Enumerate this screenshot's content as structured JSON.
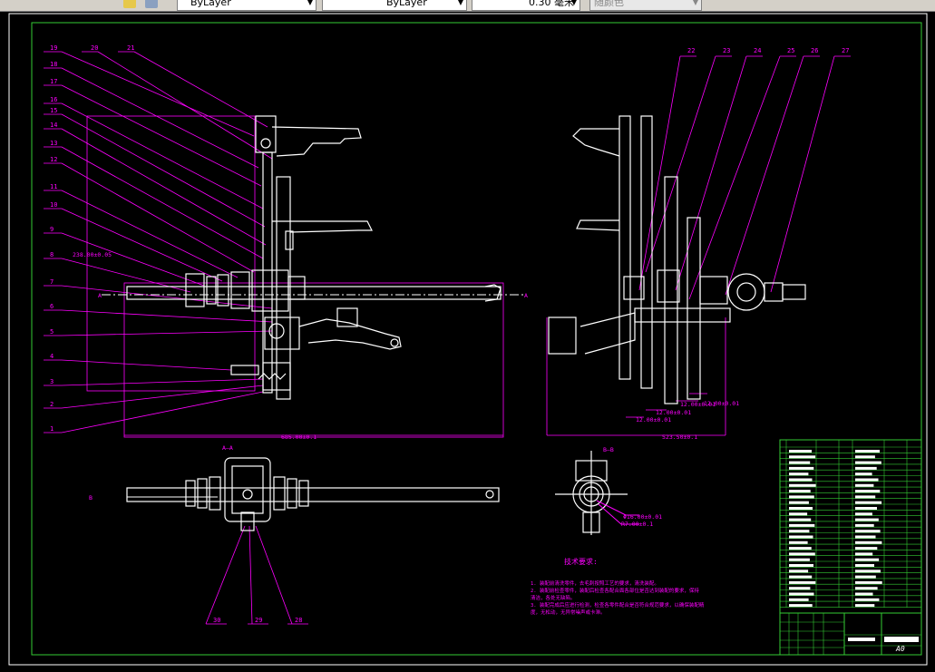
{
  "toolbar": {
    "layer_dropdown": "ByLayer",
    "linetype_dropdown": "ByLayer",
    "lineweight_dropdown": "0.30 毫米",
    "plotstyle_dropdown": "随颜色"
  },
  "colors": {
    "frame": "#33cc33",
    "annotation": "#ff00ff",
    "geometry": "#ffffff",
    "background": "#000000"
  },
  "drawing": {
    "left_labels": [
      "19",
      "18",
      "17",
      "16",
      "15",
      "14",
      "13",
      "12",
      "11",
      "10",
      "9",
      "8",
      "7",
      "6",
      "5",
      "4",
      "3",
      "2",
      "1"
    ],
    "top_labels": [
      "20",
      "21"
    ],
    "right_labels": [
      "22",
      "23",
      "24",
      "25",
      "26",
      "27"
    ],
    "bottom_labels": [
      "30",
      "29",
      "28"
    ],
    "section_a": "A—A",
    "section_b": "B—B",
    "section_marker_a": "A",
    "section_marker_b": "B",
    "dim_height": "238.00±0.05",
    "dim_width_front": "685.00±0.1",
    "dim_width_side": "523.50±0.1",
    "dim_shafts": [
      "12.00±0.01",
      "12.00±0.01",
      "12.00±0.01",
      "12.00±0.01"
    ],
    "dim_bore": "Φ16.00±0.01",
    "dim_radius": "R7.00±0.1",
    "tech_title": "技术要求:",
    "tech_notes": [
      "1. 装配前清洗零件，去毛刺按照工艺的要求，清洗装配。",
      "2. 装配前检查零件，装配后检查各配合面各部位是否达到装配的要求，保持",
      "清洁，各处无缺陷。",
      "3. 装配完成后应进行检测，检查各零件配合是否符合规范要求，以确保装配精",
      "度，无松动，无异常噪声或卡滞。"
    ],
    "sheet_size": "A0"
  }
}
